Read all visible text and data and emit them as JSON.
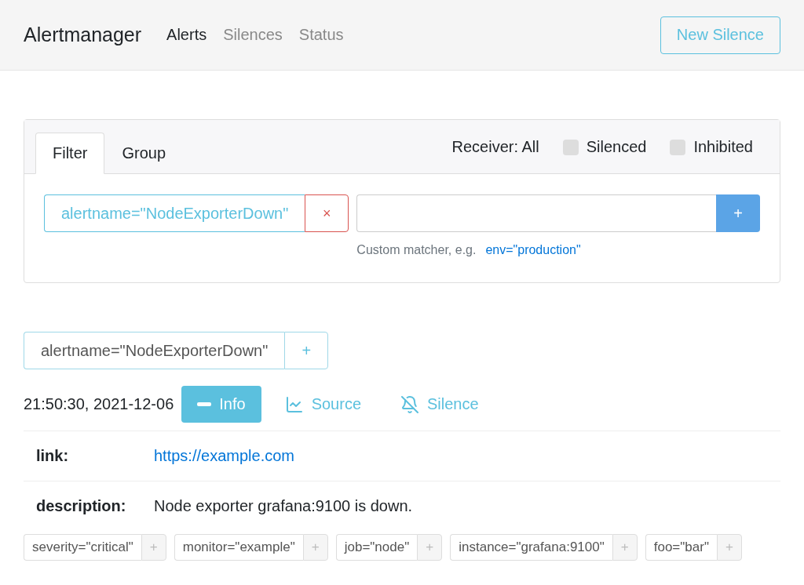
{
  "navbar": {
    "brand": "Alertmanager",
    "links": [
      {
        "label": "Alerts",
        "selected": true
      },
      {
        "label": "Silences",
        "selected": false
      },
      {
        "label": "Status",
        "selected": false
      }
    ],
    "button": "New Silence"
  },
  "filter_panel": {
    "tabs": [
      {
        "label": "Filter",
        "selected": true
      },
      {
        "label": "Group",
        "selected": false
      }
    ],
    "receiver": "Receiver: All",
    "checkboxes": [
      {
        "label": "Silenced",
        "checked": false
      },
      {
        "label": "Inhibited",
        "checked": false
      }
    ],
    "matchers": [
      {
        "text": "alertname=\"NodeExporterDown\"",
        "remove": "×"
      }
    ],
    "add_button": "+",
    "hint": "Custom matcher, e.g.",
    "hint_example": "env=\"production\""
  },
  "group": {
    "label": "alertname=\"NodeExporterDown\"",
    "add": "+"
  },
  "alert": {
    "time": "21:50:30, 2021-12-06",
    "buttons": [
      {
        "kind": "info",
        "label": "Info",
        "expanded": true
      },
      {
        "kind": "source",
        "label": "Source"
      },
      {
        "kind": "silence",
        "label": "Silence"
      }
    ],
    "annotations": [
      {
        "kind": "link",
        "key": "link:",
        "value": "https://example.com"
      },
      {
        "kind": "text",
        "key": "description:",
        "value": "Node exporter grafana:9100 is down."
      }
    ],
    "labels": [
      {
        "text": "severity=\"critical\"",
        "add": "+"
      },
      {
        "text": "monitor=\"example\"",
        "add": "+"
      },
      {
        "text": "job=\"node\"",
        "add": "+"
      },
      {
        "text": "instance=\"grafana:9100\"",
        "add": "+"
      },
      {
        "text": "foo=\"bar\"",
        "add": "+"
      }
    ]
  }
}
